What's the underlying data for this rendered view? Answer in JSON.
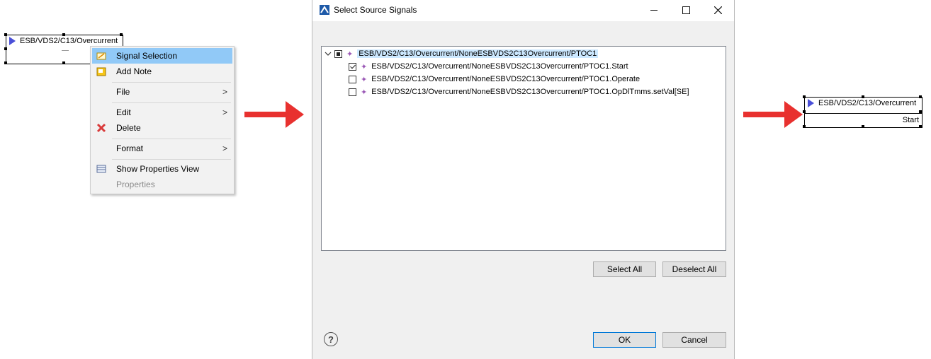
{
  "left_block": {
    "title": "ESB/VDS2/C13/Overcurrent"
  },
  "context_menu": {
    "items": [
      {
        "label": "Signal Selection",
        "icon": "signal-selection-icon",
        "highlighted": true
      },
      {
        "label": "Add Note",
        "icon": "note-icon"
      },
      {
        "label": "File",
        "submenu": true
      },
      {
        "label": "Edit",
        "submenu": true
      },
      {
        "label": "Delete",
        "icon": "delete-icon"
      },
      {
        "label": "Format",
        "submenu": true
      },
      {
        "label": "Show Properties View",
        "icon": "properties-view-icon"
      },
      {
        "label": "Properties",
        "disabled": true
      }
    ],
    "submenu_glyph": ">"
  },
  "dialog": {
    "title": "Select Source Signals",
    "tree": {
      "root": {
        "label": "ESB/VDS2/C13/Overcurrent/NoneESBVDS2C13Overcurrent/PTOC1",
        "state": "partial",
        "expanded": true
      },
      "children": [
        {
          "label": "ESB/VDS2/C13/Overcurrent/NoneESBVDS2C13Overcurrent/PTOC1.Start",
          "checked": true
        },
        {
          "label": "ESB/VDS2/C13/Overcurrent/NoneESBVDS2C13Overcurrent/PTOC1.Operate",
          "checked": false
        },
        {
          "label": "ESB/VDS2/C13/Overcurrent/NoneESBVDS2C13Overcurrent/PTOC1.OpDlTmms.setVal[SE]",
          "checked": false
        }
      ]
    },
    "select_all": "Select All",
    "deselect_all": "Deselect All",
    "ok": "OK",
    "cancel": "Cancel",
    "help_glyph": "?"
  },
  "right_block": {
    "title": "ESB/VDS2/C13/Overcurrent",
    "value": "Start"
  },
  "colors": {
    "arrow": "#e8312f",
    "highlight": "#91c9f7",
    "block_triangle": "#4a4fd8"
  }
}
